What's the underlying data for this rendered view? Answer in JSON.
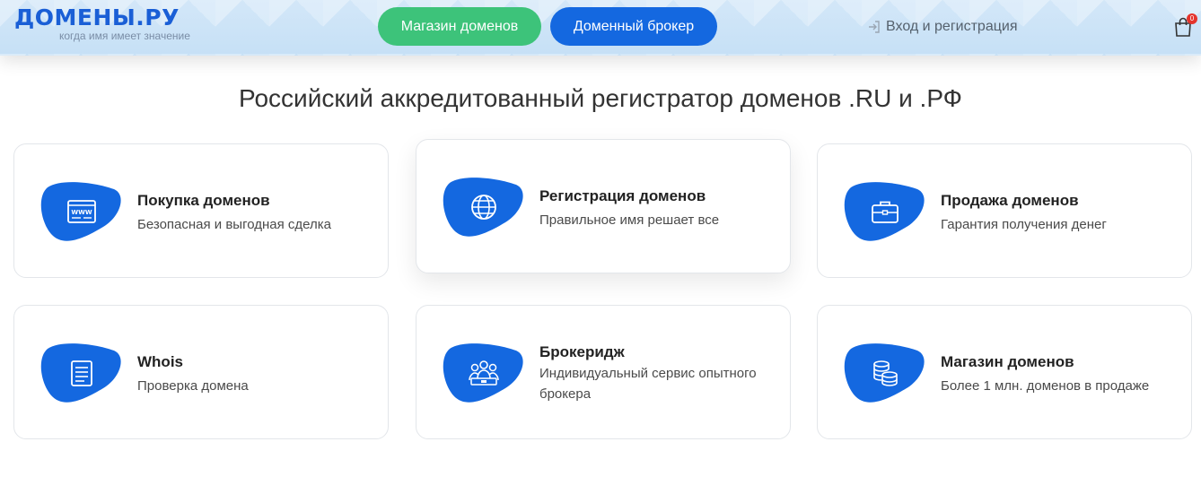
{
  "header": {
    "logo_text": "ДОМЕНЫ.РУ",
    "logo_tagline": "когда имя имеет значение",
    "shop_button": "Магазин доменов",
    "broker_button": "Доменный брокер",
    "login_link": "Вход и регистрация",
    "cart_count": "0"
  },
  "colors": {
    "brand_blue": "#1468e0",
    "green": "#3dc37a",
    "badge_red": "#e5342c"
  },
  "main": {
    "title": "Российский аккредитованный регистратор доменов .RU и .РФ",
    "services": [
      {
        "title": "Покупка доменов",
        "subtitle": "Безопасная и выгодная сделка",
        "icon": "www-browser-icon"
      },
      {
        "title": "Регистрация доменов",
        "subtitle": "Правильное имя решает все",
        "icon": "globe-icon"
      },
      {
        "title": "Продажа доменов",
        "subtitle": "Гарантия получения денег",
        "icon": "briefcase-icon"
      },
      {
        "title": "Whois",
        "subtitle": "Проверка домена",
        "icon": "document-icon"
      },
      {
        "title": "Брокеридж",
        "subtitle": "Индивидуальный сервис опытного брокера",
        "icon": "team-icon"
      },
      {
        "title": "Магазин доменов",
        "subtitle": "Более 1 млн. доменов в продаже",
        "icon": "coins-stack-icon"
      }
    ]
  }
}
